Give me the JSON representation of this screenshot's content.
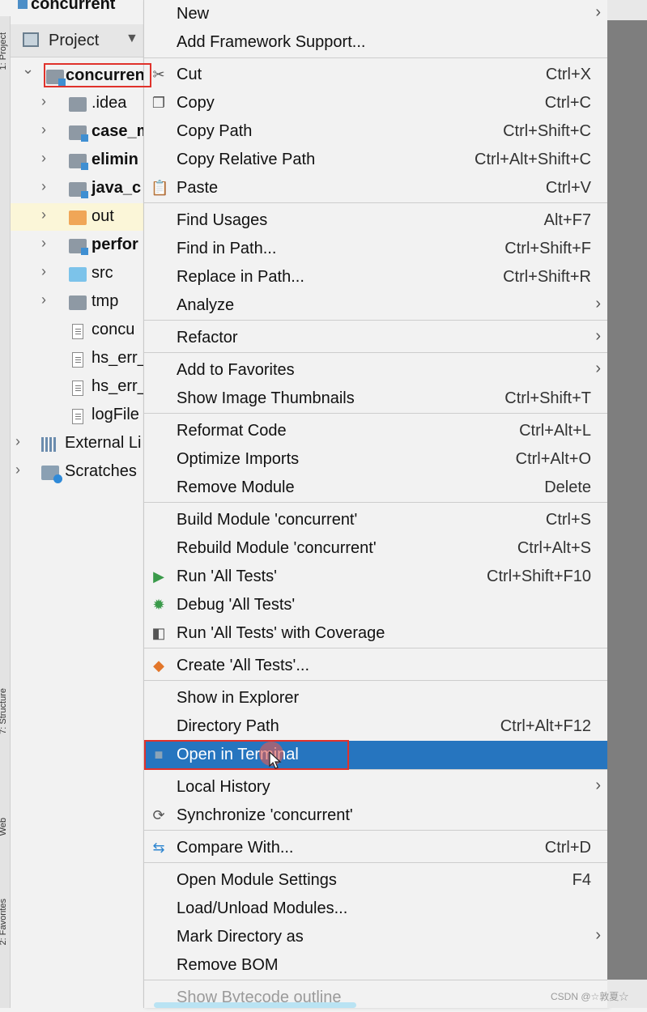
{
  "window": {
    "title": "concurrent"
  },
  "left_stripe": {
    "labels": [
      "1: Project",
      "7: Structure",
      "Web",
      "2: Favorites"
    ]
  },
  "project_panel": {
    "header_label": "Project",
    "tree": [
      {
        "label": "concurrent",
        "bold": true
      },
      {
        "label": ".idea",
        "bold": false
      },
      {
        "label": "case_m",
        "bold": true
      },
      {
        "label": "elimin",
        "bold": true
      },
      {
        "label": "java_c",
        "bold": true
      },
      {
        "label": "out",
        "bold": false
      },
      {
        "label": "perfor",
        "bold": true
      },
      {
        "label": "src",
        "bold": false
      },
      {
        "label": "tmp",
        "bold": false
      },
      {
        "label": "concu",
        "bold": false
      },
      {
        "label": "hs_err_",
        "bold": false
      },
      {
        "label": "hs_err_",
        "bold": false
      },
      {
        "label": "logFile",
        "bold": false
      },
      {
        "label": "External Li",
        "bold": false
      },
      {
        "label": "Scratches",
        "bold": false
      }
    ]
  },
  "menu": {
    "items": [
      {
        "label": "New",
        "shortcut": "",
        "submenu": true,
        "icon": ""
      },
      {
        "label": "Add Framework Support...",
        "shortcut": "",
        "submenu": false,
        "icon": ""
      },
      {
        "label": "Cut",
        "shortcut": "Ctrl+X",
        "submenu": false,
        "icon": "scissors-icon"
      },
      {
        "label": "Copy",
        "shortcut": "Ctrl+C",
        "submenu": false,
        "icon": "copy-icon"
      },
      {
        "label": "Copy Path",
        "shortcut": "Ctrl+Shift+C",
        "submenu": false,
        "icon": ""
      },
      {
        "label": "Copy Relative Path",
        "shortcut": "Ctrl+Alt+Shift+C",
        "submenu": false,
        "icon": ""
      },
      {
        "label": "Paste",
        "shortcut": "Ctrl+V",
        "submenu": false,
        "icon": "clipboard-icon"
      },
      {
        "label": "Find Usages",
        "shortcut": "Alt+F7",
        "submenu": false,
        "icon": ""
      },
      {
        "label": "Find in Path...",
        "shortcut": "Ctrl+Shift+F",
        "submenu": false,
        "icon": ""
      },
      {
        "label": "Replace in Path...",
        "shortcut": "Ctrl+Shift+R",
        "submenu": false,
        "icon": ""
      },
      {
        "label": "Analyze",
        "shortcut": "",
        "submenu": true,
        "icon": ""
      },
      {
        "label": "Refactor",
        "shortcut": "",
        "submenu": true,
        "icon": ""
      },
      {
        "label": "Add to Favorites",
        "shortcut": "",
        "submenu": true,
        "icon": ""
      },
      {
        "label": "Show Image Thumbnails",
        "shortcut": "Ctrl+Shift+T",
        "submenu": false,
        "icon": ""
      },
      {
        "label": "Reformat Code",
        "shortcut": "Ctrl+Alt+L",
        "submenu": false,
        "icon": ""
      },
      {
        "label": "Optimize Imports",
        "shortcut": "Ctrl+Alt+O",
        "submenu": false,
        "icon": ""
      },
      {
        "label": "Remove Module",
        "shortcut": "Delete",
        "submenu": false,
        "icon": ""
      },
      {
        "label": "Build Module 'concurrent'",
        "shortcut": "Ctrl+S",
        "submenu": false,
        "icon": ""
      },
      {
        "label": "Rebuild Module 'concurrent'",
        "shortcut": "Ctrl+Alt+S",
        "submenu": false,
        "icon": ""
      },
      {
        "label": "Run 'All Tests'",
        "shortcut": "Ctrl+Shift+F10",
        "submenu": false,
        "icon": "run-icon"
      },
      {
        "label": "Debug 'All Tests'",
        "shortcut": "",
        "submenu": false,
        "icon": "debug-icon"
      },
      {
        "label": "Run 'All Tests' with Coverage",
        "shortcut": "",
        "submenu": false,
        "icon": "coverage-icon"
      },
      {
        "label": "Create 'All Tests'...",
        "shortcut": "",
        "submenu": false,
        "icon": "create-config-icon"
      },
      {
        "label": "Show in Explorer",
        "shortcut": "",
        "submenu": false,
        "icon": ""
      },
      {
        "label": "Directory Path",
        "shortcut": "Ctrl+Alt+F12",
        "submenu": false,
        "icon": ""
      },
      {
        "label": "Open in Terminal",
        "shortcut": "",
        "submenu": false,
        "icon": "terminal-icon",
        "selected": true
      },
      {
        "label": "Local History",
        "shortcut": "",
        "submenu": true,
        "icon": ""
      },
      {
        "label": "Synchronize 'concurrent'",
        "shortcut": "",
        "submenu": false,
        "icon": "sync-icon"
      },
      {
        "label": "Compare With...",
        "shortcut": "Ctrl+D",
        "submenu": false,
        "icon": "compare-icon"
      },
      {
        "label": "Open Module Settings",
        "shortcut": "F4",
        "submenu": false,
        "icon": ""
      },
      {
        "label": "Load/Unload Modules...",
        "shortcut": "",
        "submenu": false,
        "icon": ""
      },
      {
        "label": "Mark Directory as",
        "shortcut": "",
        "submenu": true,
        "icon": ""
      },
      {
        "label": "Remove BOM",
        "shortcut": "",
        "submenu": false,
        "icon": ""
      },
      {
        "label": "Show Bytecode outline",
        "shortcut": "",
        "submenu": false,
        "icon": "",
        "disabled": true
      }
    ]
  },
  "watermark": "CSDN @☆敦夏☆"
}
